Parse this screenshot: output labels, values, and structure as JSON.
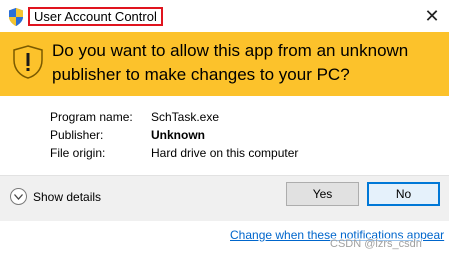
{
  "window": {
    "title": "User Account Control"
  },
  "banner": {
    "question": "Do you want to allow this app from an unknown publisher to make changes to your PC?"
  },
  "details": [
    {
      "label": "Program name:",
      "value": "SchTask.exe",
      "bold": false
    },
    {
      "label": "Publisher:",
      "value": "Unknown",
      "bold": true
    },
    {
      "label": "File origin:",
      "value": "Hard drive on this computer",
      "bold": false
    }
  ],
  "footer": {
    "show_details_label": "Show details",
    "yes_label": "Yes",
    "no_label": "No"
  },
  "notifications_link": "Change when these notifications appear",
  "watermark": "CSDN @lzrs_csdn",
  "icons": {
    "title": "shield-icon",
    "banner": "warning-shield-icon",
    "close": "close-icon",
    "expand": "chevron-down-icon"
  },
  "colors": {
    "banner": "#fcc22b",
    "highlight_border": "#e0141e",
    "link": "#0066cc",
    "no_border": "#0078d7"
  }
}
